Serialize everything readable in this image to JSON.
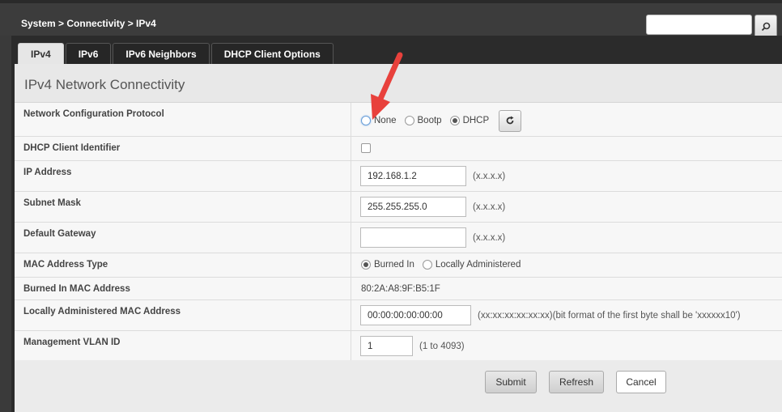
{
  "header": {
    "breadcrumb": "System > Connectivity > IPv4",
    "search": {
      "value": ""
    },
    "search_icon": "search-icon"
  },
  "tabs": [
    {
      "label": "IPv4",
      "active": true
    },
    {
      "label": "IPv6",
      "active": false
    },
    {
      "label": "IPv6 Neighbors",
      "active": false
    },
    {
      "label": "DHCP Client Options",
      "active": false
    }
  ],
  "page": {
    "title": "IPv4 Network Connectivity"
  },
  "fields": {
    "protocol": {
      "label": "Network Configuration Protocol",
      "options": [
        "None",
        "Bootp",
        "DHCP"
      ],
      "selected": "DHCP",
      "refresh_icon": "refresh-icon"
    },
    "dhcp_client_id": {
      "label": "DHCP Client Identifier",
      "checked": false
    },
    "ip_address": {
      "label": "IP Address",
      "value": "192.168.1.2",
      "hint": "(x.x.x.x)"
    },
    "subnet_mask": {
      "label": "Subnet Mask",
      "value": "255.255.255.0",
      "hint": "(x.x.x.x)"
    },
    "default_gateway": {
      "label": "Default Gateway",
      "value": "",
      "hint": "(x.x.x.x)"
    },
    "mac_type": {
      "label": "MAC Address Type",
      "options": [
        "Burned In",
        "Locally Administered"
      ],
      "selected": "Burned In"
    },
    "burned_mac": {
      "label": "Burned In MAC Address",
      "value": "80:2A:A8:9F:B5:1F"
    },
    "local_mac": {
      "label": "Locally Administered MAC Address",
      "value": "00:00:00:00:00:00",
      "hint": "(xx:xx:xx:xx:xx:xx)(bit format of the first byte shall be 'xxxxxx10')"
    },
    "mgmt_vlan": {
      "label": "Management VLAN ID",
      "value": "1",
      "hint": "(1 to 4093)"
    }
  },
  "buttons": {
    "submit": "Submit",
    "refresh": "Refresh",
    "cancel": "Cancel"
  },
  "colors": {
    "annotation_arrow": "#e8413c"
  }
}
